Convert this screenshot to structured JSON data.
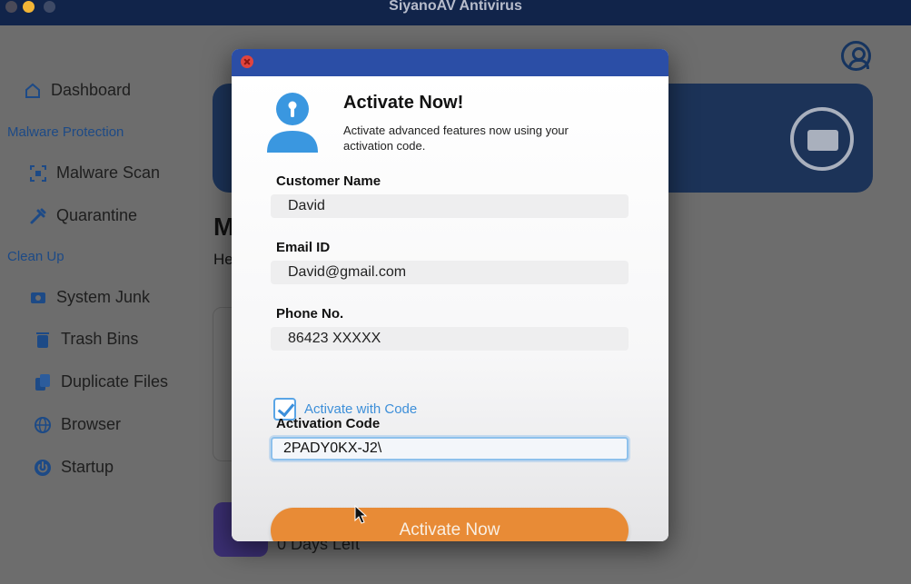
{
  "window": {
    "title": "SiyanoAV Antivirus"
  },
  "sidebar": {
    "items": [
      {
        "label": "Dashboard",
        "icon": "home-icon"
      },
      {
        "label": "Malware Scan",
        "icon": "scan-icon"
      },
      {
        "label": "Quarantine",
        "icon": "syringe-icon"
      },
      {
        "label": "System Junk",
        "icon": "junk-icon"
      },
      {
        "label": "Trash Bins",
        "icon": "trash-icon"
      },
      {
        "label": "Duplicate Files",
        "icon": "files-icon"
      },
      {
        "label": "Browser",
        "icon": "globe-icon"
      },
      {
        "label": "Startup",
        "icon": "power-icon"
      }
    ],
    "sections": [
      "Malware Protection",
      "Clean Up"
    ]
  },
  "background": {
    "heading": "M",
    "sub": "He",
    "days_left": "0 Days Left"
  },
  "dialog": {
    "title": "Activate Now!",
    "description": "Activate advanced features now using your activation code.",
    "fields": {
      "customer_name": {
        "label": "Customer Name",
        "value": "David"
      },
      "email": {
        "label": "Email ID",
        "value": "David@gmail.com"
      },
      "phone": {
        "label": "Phone No.",
        "value": "86423 XXXXX"
      },
      "activation_code": {
        "label": "Activation Code",
        "value": "2PADY0KX-J2\\"
      }
    },
    "checkbox": {
      "label": "Activate with Code",
      "checked": true
    },
    "button_label": "Activate Now"
  },
  "colors": {
    "titlebar": "#11244a",
    "dialog_header": "#2b4ea6",
    "accent_blue": "#3d8fd9",
    "button_orange": "#e88b36"
  }
}
